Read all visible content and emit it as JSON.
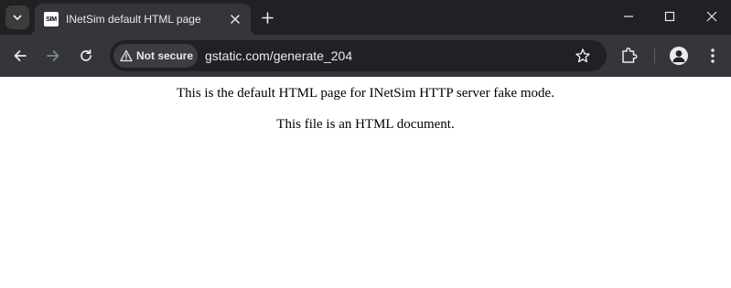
{
  "browser": {
    "tab": {
      "favicon_text": "SIM",
      "title": "INetSim default HTML page"
    },
    "address_bar": {
      "security_label": "Not secure",
      "url": "gstatic.com/generate_204"
    }
  },
  "page": {
    "paragraphs": [
      "This is the default HTML page for INetSim HTTP server fake mode.",
      "This file is an HTML document."
    ]
  }
}
